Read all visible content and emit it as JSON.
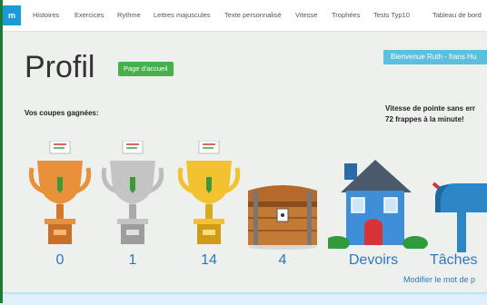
{
  "nav": {
    "home_glyph": "m",
    "items": [
      "Histoires",
      "Exercices",
      "Rythme",
      "Lettres majuscules",
      "Texte personnalisé",
      "Vitesse",
      "Trophées",
      "Tests Typ10",
      "Tableau de bord"
    ]
  },
  "page": {
    "title": "Profil",
    "home_button": "Page d'accueil",
    "welcome": "Bienvenue Ruth - frans Hu",
    "cups_label": "Vos coupes gagnées:",
    "speed_line1": "Vitesse de pointe sans err",
    "speed_line2": "72 frappes à la minute!"
  },
  "awards": [
    {
      "kind": "bronze-cup",
      "count": "0",
      "color": "#e8913a"
    },
    {
      "kind": "silver-cup",
      "count": "1",
      "color": "#c4c4c4"
    },
    {
      "kind": "gold-cup",
      "count": "14",
      "color": "#f2c230"
    },
    {
      "kind": "treasure-chest",
      "count": "4",
      "color": "#b5692b"
    },
    {
      "kind": "house",
      "count": "Devoirs",
      "color": "#3f8fd8"
    },
    {
      "kind": "mailbox",
      "count": "Tâches",
      "color": "#2f86c7"
    }
  ],
  "footer": {
    "change_password": "Modifier le mot de p"
  },
  "colors": {
    "accent_blue": "#2e77c0",
    "home_button": "#46b04a",
    "welcome_bg": "#5bc0de"
  }
}
